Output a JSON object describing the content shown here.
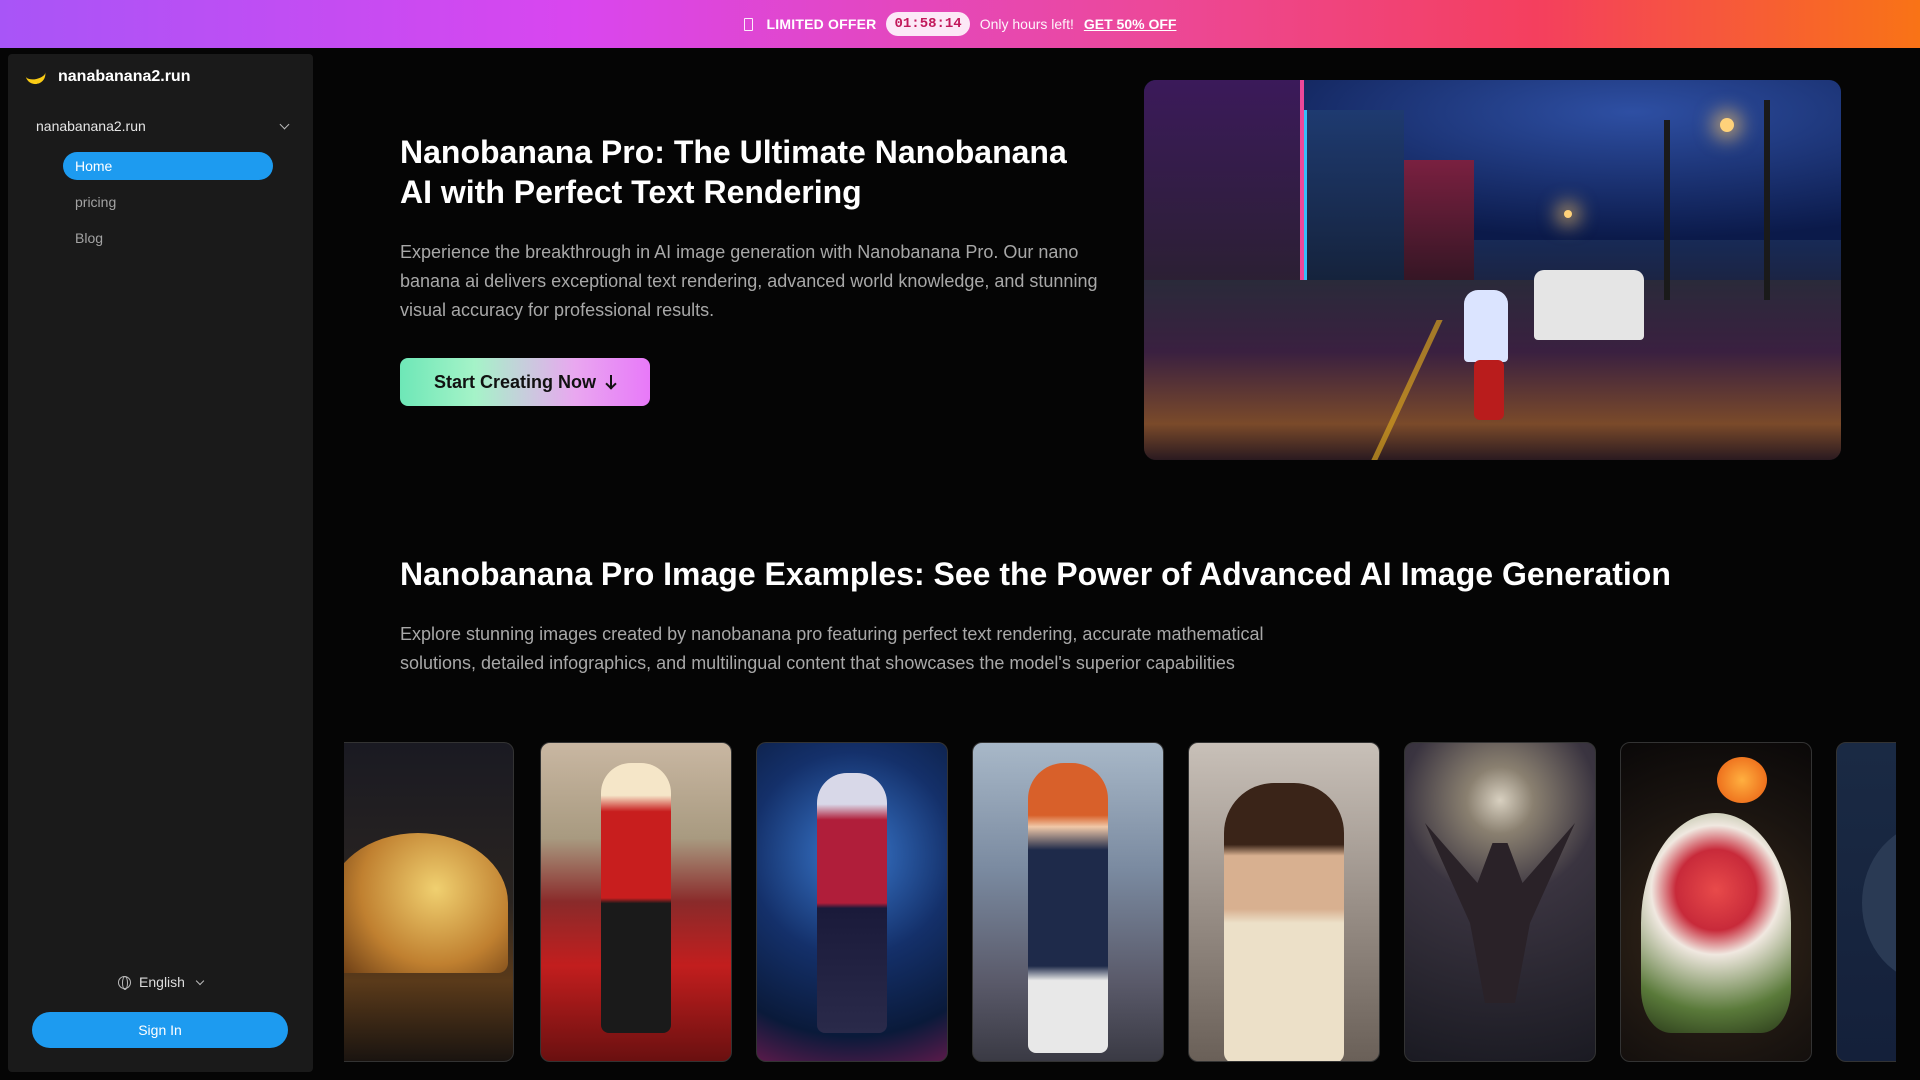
{
  "promo": {
    "label": "LIMITED OFFER",
    "timer": "01:58:14",
    "message": "Only hours left!",
    "cta": "GET 50% OFF"
  },
  "sidebar": {
    "brand": "nanabanana2.run",
    "site_selector": "nanabanana2.run",
    "nav": [
      {
        "label": "Home",
        "active": true
      },
      {
        "label": "pricing",
        "active": false
      },
      {
        "label": "Blog",
        "active": false
      }
    ],
    "language": "English",
    "sign_in": "Sign In"
  },
  "hero": {
    "title": "Nanobanana Pro: The Ultimate Nanobanana AI with Perfect Text Rendering",
    "description": "Experience the breakthrough in AI image generation with Nanobanana Pro. Our nano banana ai delivers exceptional text rendering, advanced world knowledge, and stunning visual accuracy for professional results.",
    "cta": "Start Creating Now"
  },
  "examples": {
    "title": "Nanobanana Pro Image Examples: See the Power of Advanced AI Image Generation",
    "description": "Explore stunning images created by nanobanana pro featuring perfect text rendering, accurate mathematical solutions, detailed infographics, and multilingual content that showcases the model's superior capabilities"
  },
  "colors": {
    "accent": "#1d9bf0",
    "sidebar_bg": "#1a1a1a",
    "page_bg": "#050505",
    "promo_gradient_start": "#a855f7",
    "promo_gradient_end": "#f97316"
  }
}
